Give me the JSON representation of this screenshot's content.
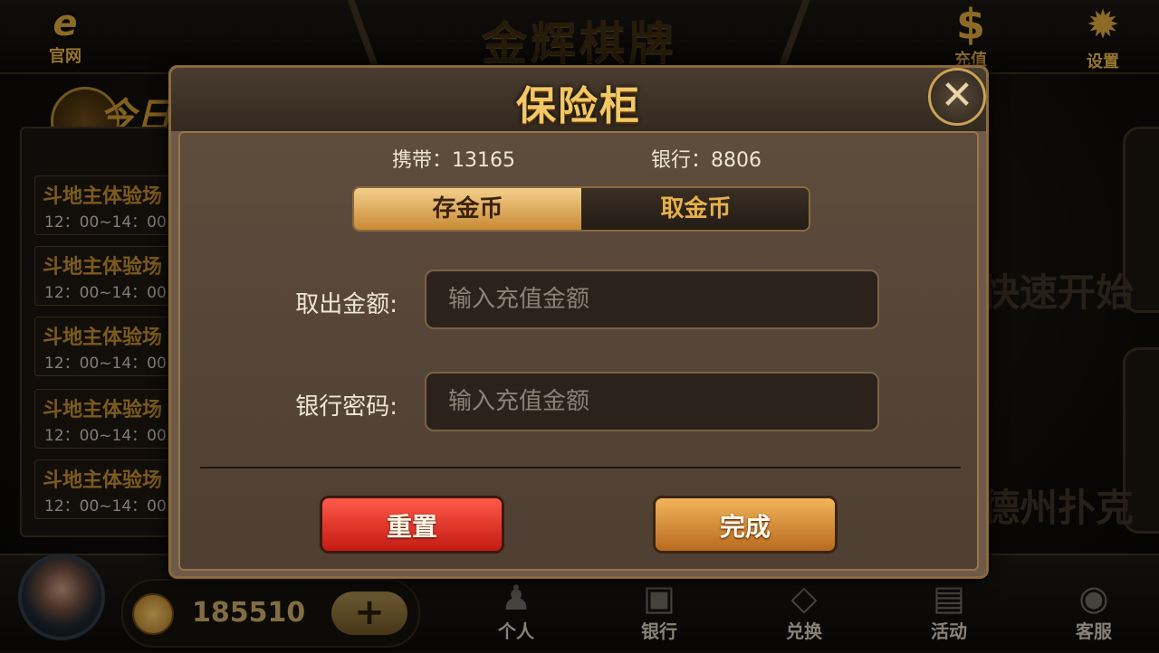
{
  "topbar": {
    "official_label": "官网",
    "brand_title": "金辉棋牌",
    "recharge_label": "充值",
    "settings_label": "设置"
  },
  "left_panel": {
    "header_text": "今日",
    "items": [
      {
        "title": "斗地主体验场",
        "time": "12：00~14：00"
      },
      {
        "title": "斗地主体验场",
        "time": "12：00~14：00"
      },
      {
        "title": "斗地主体验场",
        "time": "12：00~14：00"
      },
      {
        "title": "斗地主体验场",
        "time": "12：00~14：00"
      },
      {
        "title": "斗地主体验场",
        "time": "12：00~14：00"
      }
    ]
  },
  "background_tiles": {
    "tile1": "快速开始",
    "tile2": "德州扑克"
  },
  "bottombar": {
    "coins": "185510",
    "nav": [
      {
        "label": "个人",
        "icon": "person-icon"
      },
      {
        "label": "银行",
        "icon": "safe-icon"
      },
      {
        "label": "兑换",
        "icon": "diamond-icon"
      },
      {
        "label": "活动",
        "icon": "gift-icon"
      },
      {
        "label": "客服",
        "icon": "headset-icon"
      }
    ]
  },
  "modal": {
    "title": "保险柜",
    "carry_text": "携带：13165",
    "bank_text": "银行：8806",
    "tabs": [
      {
        "label": "存金币",
        "active": true
      },
      {
        "label": "取金币",
        "active": false
      }
    ],
    "amount_label": "取出金额:",
    "amount_placeholder": "输入充值金额",
    "password_label": "银行密码:",
    "password_placeholder": "输入充值金额",
    "reset_label": "重置",
    "done_label": "完成"
  },
  "colors": {
    "gold": "#f2c766",
    "reset_red": "#d6281c",
    "done_orange": "#d98a32"
  }
}
